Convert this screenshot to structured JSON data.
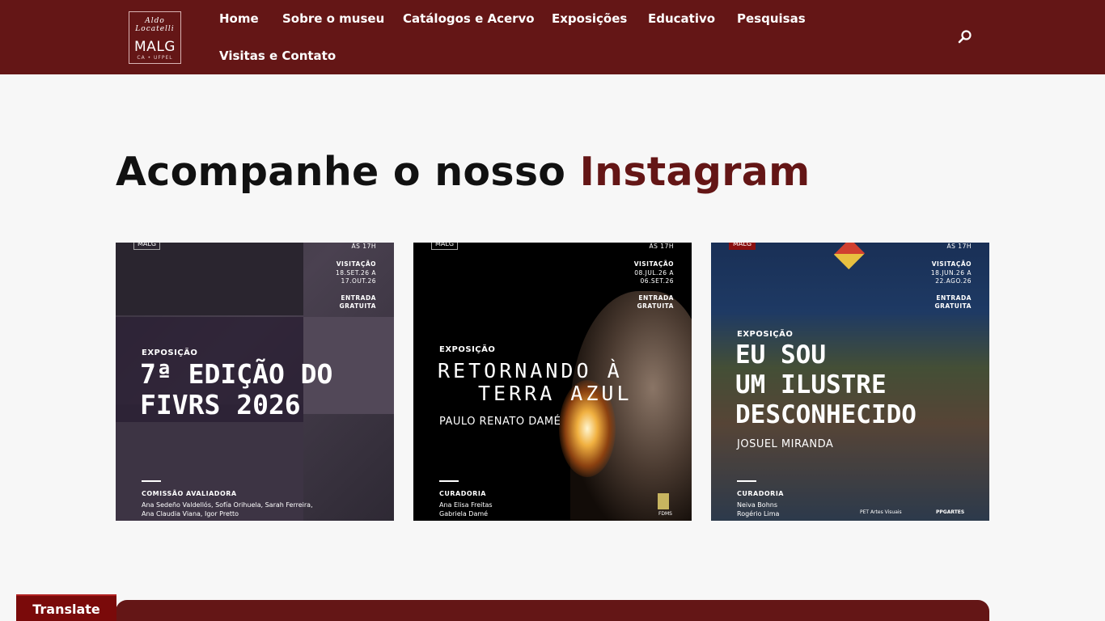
{
  "header": {
    "logo": {
      "signature": "Aldo Locatelli",
      "name": "MALG",
      "sub": "CA • UFPEL"
    },
    "nav": [
      "Home",
      "Sobre o museu",
      "Catálogos e Acervo",
      "Exposições",
      "Educativo",
      "Pesquisas",
      "Visitas e Contato"
    ],
    "search_icon": "search-icon"
  },
  "section": {
    "title_main": "Acompanhe o nosso ",
    "title_accent": "Instagram"
  },
  "posts": [
    {
      "logo": "MALG",
      "time": "ÀS 17H",
      "visit_label": "VISITAÇÃO",
      "visit_dates": "18.SET.26 A",
      "visit_dates2": "17.OUT.26",
      "entry1": "ENTRADA",
      "entry2": "GRATUITA",
      "kicker": "EXPOSIÇÃO",
      "headline1": "7ª EDIÇÃO DO",
      "headline2": "FIVRS 2026",
      "credits_heading": "COMISSÃO AVALIADORA",
      "credits1": "Ana Sedeño Valdellós, Sofía Orihuela, Sarah Ferreira,",
      "credits2": "Ana Claudia Viana, Igor  Pretto"
    },
    {
      "logo": "MALG",
      "time": "ÀS 17H",
      "visit_label": "VISITAÇÃO",
      "visit_dates": "08.JUL.26 A",
      "visit_dates2": "06.SET.26",
      "entry1": "ENTRADA",
      "entry2": "GRATUITA",
      "kicker": "EXPOSIÇÃO",
      "headline1": "RETORNANDO À",
      "headline2": "TERRA AZUL",
      "artist": "PAULO RENATO DAMÉ",
      "credits_heading": "CURADORIA",
      "credits1": "Ana Elisa Freitas",
      "credits2": "Gabriela Damé",
      "sponsor": "FDMS"
    },
    {
      "logo": "MALG",
      "time": "ÀS 17H",
      "visit_label": "VISITAÇÃO",
      "visit_dates": "18.JUN.26 A",
      "visit_dates2": "22.AGO.26",
      "entry1": "ENTRADA",
      "entry2": "GRATUITA",
      "kicker": "EXPOSIÇÃO",
      "headline1": "EU SOU",
      "headline2": "UM ILUSTRE",
      "headline3": "DESCONHECIDO",
      "artist": "JOSUEL MIRANDA",
      "credits_heading": "CURADORIA",
      "credits1": "Neiva Bohns",
      "credits2": "Rogério Lima",
      "sponsor1": "PET Artes Visuais",
      "sponsor2": "PPGARTES"
    }
  ],
  "translate": {
    "label": "Translate"
  }
}
